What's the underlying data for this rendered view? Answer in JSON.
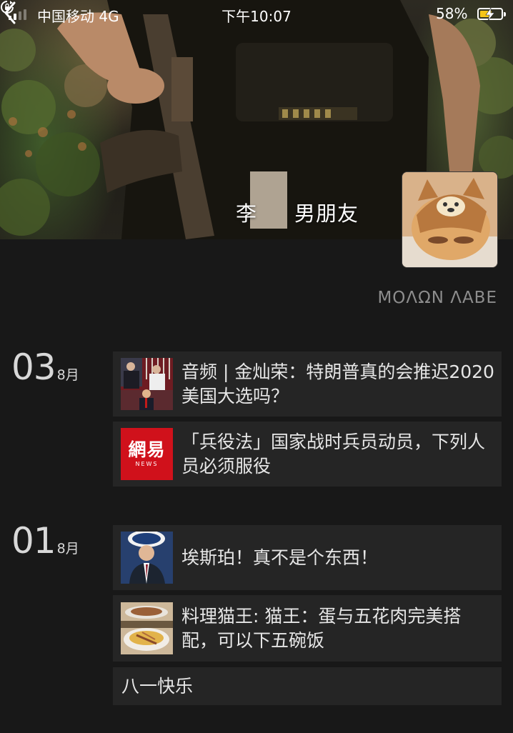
{
  "status_bar": {
    "carrier": "中国移动 4G",
    "time": "下午10:07",
    "battery_percent": "58%",
    "battery_level": 0.58
  },
  "profile": {
    "name_prefix": "李",
    "name_suffix": "男朋友",
    "signature": "ΜΟΛΩΝ ΛΑΒΕ"
  },
  "timeline": [
    {
      "day": "03",
      "month": "8月",
      "posts": [
        {
          "text": "音频 | 金灿荣：特朗普真的会推迟2020美国大选吗？",
          "thumb": "news-photo-thumbnail"
        },
        {
          "text": "「兵役法」国家战时兵员动员，下列人员必须服役",
          "thumb": "netease-news-logo",
          "logo_main": "網易",
          "logo_sub": "NEWS"
        }
      ]
    },
    {
      "day": "01",
      "month": "8月",
      "posts": [
        {
          "text": "埃斯珀！真不是个东西！",
          "thumb": "press-briefing-thumbnail"
        },
        {
          "text": "料理猫王: 猫王：蛋与五花肉完美搭配，可以下五碗饭",
          "thumb": "food-dish-thumbnail"
        },
        {
          "text": "八一快乐"
        }
      ]
    }
  ],
  "colors": {
    "background": "#181818",
    "card": "#252525",
    "netease_red": "#d0111b",
    "battery_fill": "#f5c518"
  }
}
